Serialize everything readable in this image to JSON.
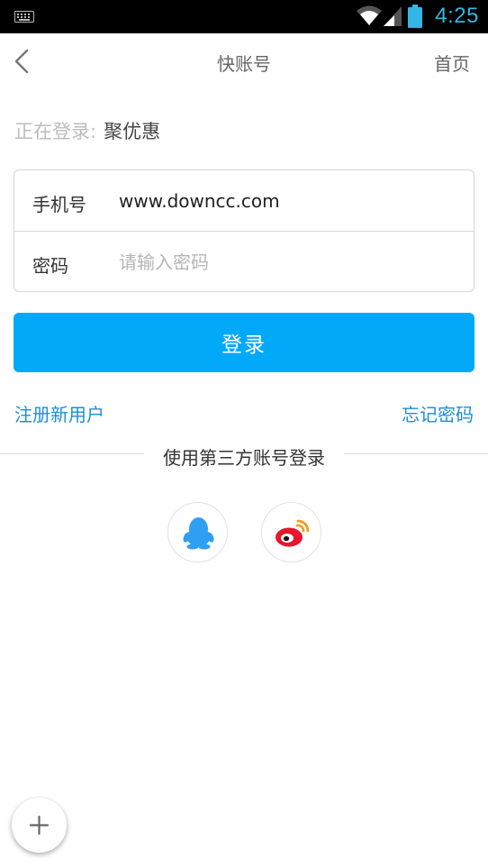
{
  "status_bar": {
    "time": "4:25",
    "icons": [
      "keyboard-icon",
      "wifi-icon",
      "signal-icon",
      "battery-icon"
    ],
    "time_color": "#33b5e5"
  },
  "nav": {
    "title": "快账号",
    "home_label": "首页",
    "back_icon": "chevron-left-icon"
  },
  "account": {
    "label": "正在登录:",
    "name": "聚优惠"
  },
  "form": {
    "phone_label": "手机号",
    "phone_value": "www.downcc.com",
    "password_label": "密码",
    "password_placeholder": "请输入密码"
  },
  "login_button": {
    "label": "登录",
    "color": "#03a9f9"
  },
  "links": {
    "register": "注册新用户",
    "forgot": "忘记密码",
    "color": "#1a8fd9"
  },
  "third_party": {
    "title": "使用第三方账号登录",
    "providers": [
      {
        "id": "qq",
        "icon": "qq-penguin-icon",
        "color": "#2f9ff2"
      },
      {
        "id": "weibo",
        "icon": "weibo-icon",
        "color": "#e6162d"
      }
    ]
  },
  "fab": {
    "icon": "plus-icon"
  }
}
